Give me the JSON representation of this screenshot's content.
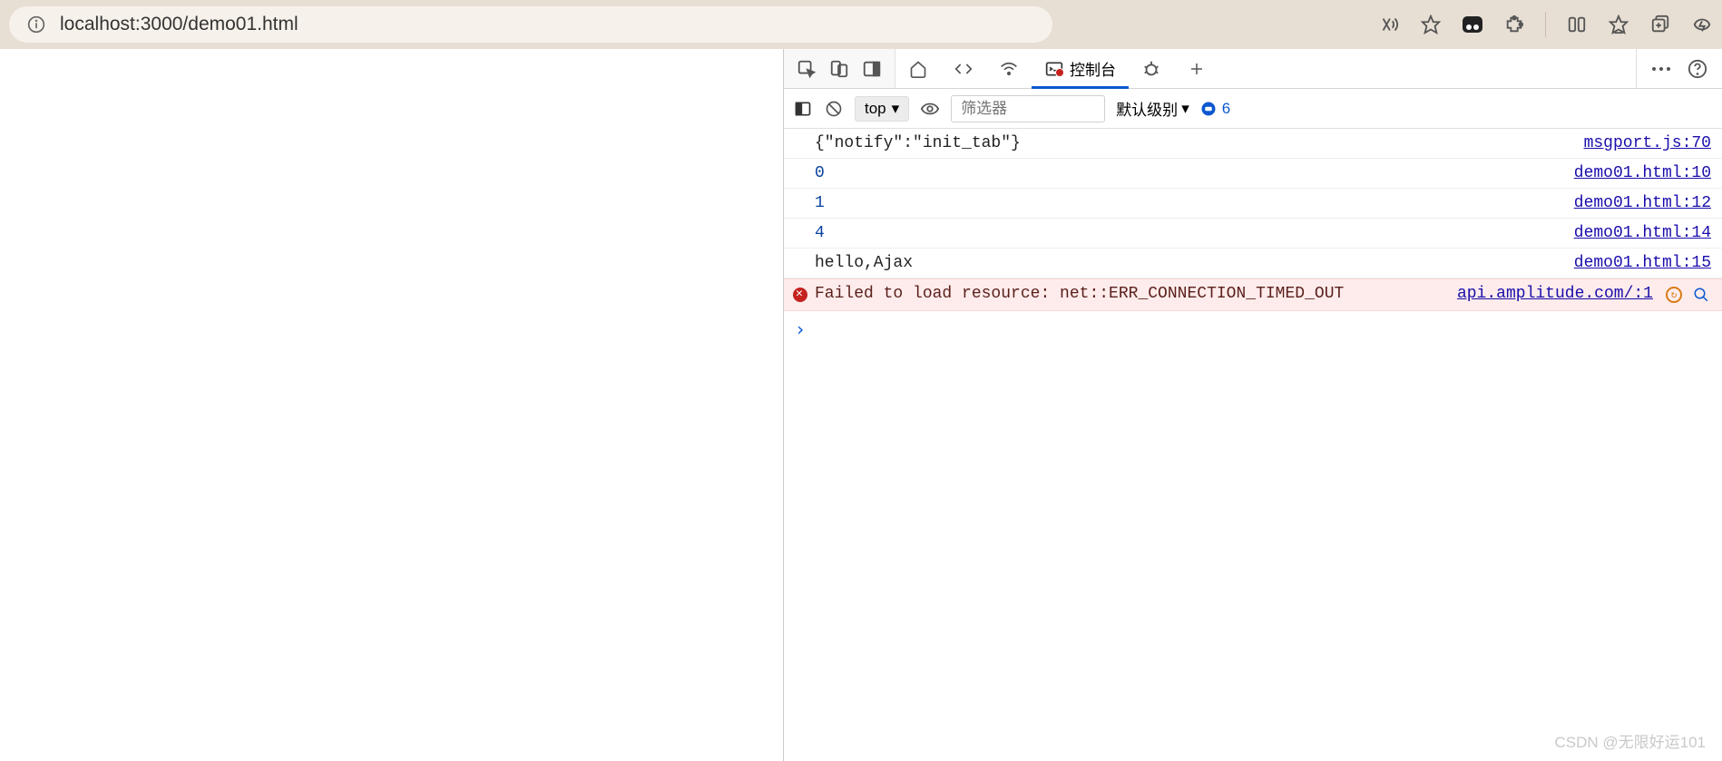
{
  "browser": {
    "url_display": "localhost:3000/demo01.html"
  },
  "devtools": {
    "tabs": {
      "console_label": "控制台"
    },
    "toolbar": {
      "context_label": "top",
      "filter_placeholder": "筛选器",
      "level_label": "默认级别",
      "issues_count": "6"
    },
    "rows": [
      {
        "type": "txt",
        "msg": "{\"notify\":\"init_tab\"}",
        "src": "msgport.js:70"
      },
      {
        "type": "num",
        "msg": "0",
        "src": "demo01.html:10"
      },
      {
        "type": "num",
        "msg": "1",
        "src": "demo01.html:12"
      },
      {
        "type": "num",
        "msg": "4",
        "src": "demo01.html:14"
      },
      {
        "type": "txt",
        "msg": "hello,Ajax",
        "src": "demo01.html:15"
      },
      {
        "type": "err",
        "msg": "Failed to load resource: net::ERR_CONNECTION_TIMED_OUT",
        "src": "api.amplitude.com/:1"
      }
    ],
    "prompt": "›"
  },
  "watermark": "CSDN @无限好运101"
}
